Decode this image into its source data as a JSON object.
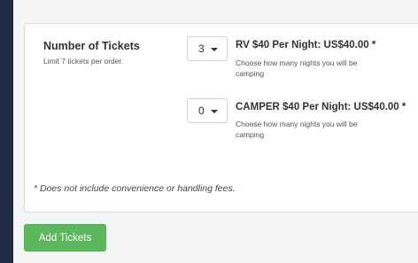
{
  "tickets_section": {
    "heading": "Number of Tickets",
    "limit_note": "Limit 7 tickets per order."
  },
  "ticket_options": [
    {
      "quantity": "3",
      "name": "RV $40 Per Night: US$40.00 *",
      "description": "Choose how many nights you will be camping"
    },
    {
      "quantity": "0",
      "name": "CAMPER $40 Per Night: US$40.00 *",
      "description": "Choose how many nights you will be camping"
    }
  ],
  "fees_note": "* Does not include convenience or handling fees.",
  "add_button_label": "Add Tickets",
  "colors": {
    "page_background": "#232a44",
    "content_background": "#f4f5f6",
    "add_button": "#5cb85c"
  }
}
